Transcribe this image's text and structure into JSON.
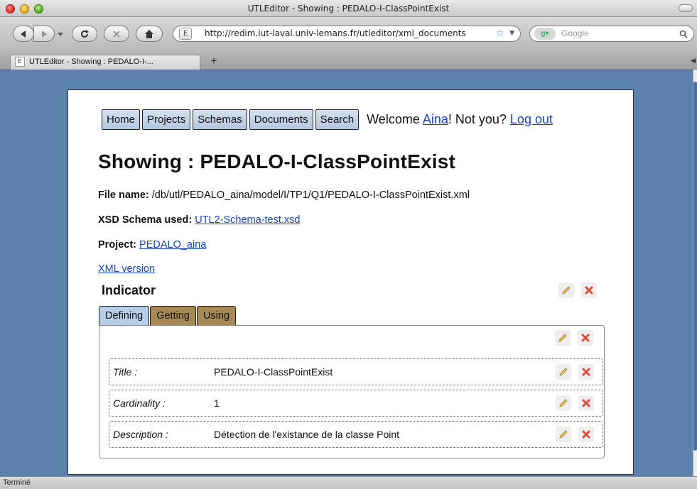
{
  "window": {
    "title": "UTLEditor - Showing : PEDALO-I-ClassPointExist"
  },
  "toolbar": {
    "url": "http://redim.iut-laval.univ-lemans.fr/utleditor/xml_documents",
    "search_placeholder": "Google",
    "favicon_label": "E"
  },
  "tabs": [
    {
      "label": "UTLEditor - Showing : PEDALO-I-..."
    }
  ],
  "status": "Terminé",
  "page": {
    "menu": [
      "Home",
      "Projects",
      "Schemas",
      "Documents",
      "Search"
    ],
    "welcome_prefix": "Welcome ",
    "user": "Aina",
    "welcome_mid": "! Not you? ",
    "logout": "Log out",
    "heading": "Showing : PEDALO-I-ClassPointExist",
    "file_label": "File name:",
    "file_value": " /db/utl/PEDALO_aina/model/I/TP1/Q1/PEDALO-I-ClassPointExist.xml",
    "schema_label": "XSD Schema used:",
    "schema_value": "UTL2-Schema-test.xsd",
    "project_label": "Project:",
    "project_value": "PEDALO_aina",
    "xml_version": "XML version",
    "indicator_title": "Indicator",
    "tabs": [
      "Defining",
      "Getting",
      "Using"
    ],
    "active_tab": "Defining",
    "fields": [
      {
        "label": "Title",
        "sep": " :",
        "value": "PEDALO-I-ClassPointExist"
      },
      {
        "label": "Cardinality",
        "sep": " :",
        "value": "1"
      },
      {
        "label": "Description",
        "sep": " :",
        "value": "Détection de l'existance de la classe Point"
      }
    ]
  },
  "colors": {
    "page_background": "#5a82ad",
    "menu_button": "#c3d4e8",
    "active_tab": "#b7cde8",
    "inactive_tab": "#a58a55",
    "link": "#1a44c8",
    "delete_icon": "#e04a3a",
    "edit_icon": "#d8b45a"
  },
  "icons": [
    "back-icon",
    "forward-icon",
    "reload-icon",
    "stop-icon",
    "home-icon",
    "bookmark-star-icon",
    "search-icon",
    "edit-pencil-icon",
    "delete-x-icon"
  ]
}
